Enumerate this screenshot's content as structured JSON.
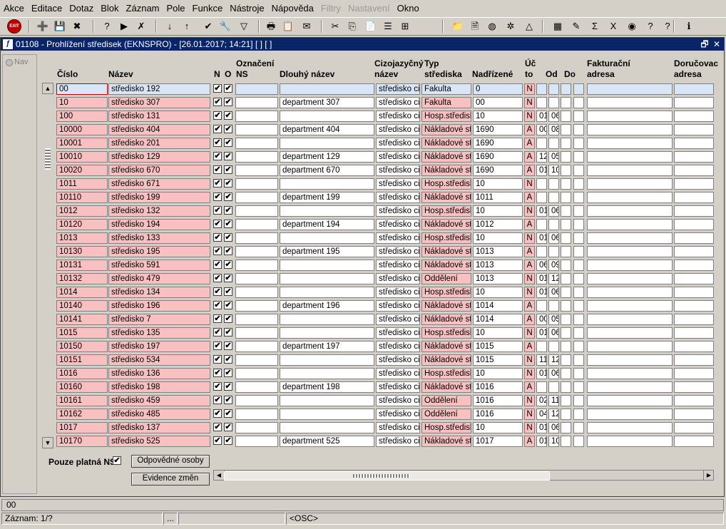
{
  "menu": [
    "Akce",
    "Editace",
    "Dotaz",
    "Blok",
    "Záznam",
    "Pole",
    "Funkce",
    "Nástroje",
    "Nápověda",
    "Filtry",
    "Nastavení",
    "Okno"
  ],
  "menu_disabled": [
    "Filtry",
    "Nastavení"
  ],
  "toolbar": {
    "exit_label": "EXIT",
    "icons": [
      "exit-icon",
      "insert-record-icon",
      "save-icon",
      "delete-record-icon",
      "enter-query-icon",
      "execute-query-icon",
      "cancel-query-icon",
      "sort-ascending-icon",
      "sort-descending-icon",
      "confirm-icon",
      "wrench-icon",
      "filter-icon",
      "print-icon",
      "export-icon",
      "email-icon",
      "cut-icon",
      "copy-icon",
      "paste-icon",
      "list-icon",
      "tree-icon",
      "folder-icon",
      "document-icon",
      "globe-icon",
      "settings-icon",
      "chart-icon",
      "calculator-icon",
      "edit-icon",
      "sum-icon",
      "excel-icon",
      "world-icon",
      "help-icon",
      "question-icon",
      "info-icon"
    ]
  },
  "window": {
    "title": "01108 - Prohlížení středisek (EKNSPRO) - [26.01.2017; 14:21] [ ] [ ]",
    "restore_glyph": "🗗",
    "close_glyph": "✕"
  },
  "nav": {
    "label": "Nav"
  },
  "columns": [
    {
      "key": "cislo",
      "label": "Číslo"
    },
    {
      "key": "nazev",
      "label": "Název"
    },
    {
      "key": "n",
      "label": "N"
    },
    {
      "key": "o",
      "label": "O"
    },
    {
      "key": "oznaceni",
      "label": "Označení\nNS"
    },
    {
      "key": "dlouhy",
      "label": "Dlouhý název"
    },
    {
      "key": "cizojazycny",
      "label": "Cizojazyčný\nnázev"
    },
    {
      "key": "typ",
      "label": "Typ\nstřediska"
    },
    {
      "key": "nadrizene",
      "label": "Nadřízené"
    },
    {
      "key": "uc",
      "label": "Úč\nto"
    },
    {
      "key": "od",
      "label": "Od"
    },
    {
      "key": "do",
      "label": "Do"
    },
    {
      "key": "fakturacni",
      "label": "Fakturační\nadresa"
    },
    {
      "key": "dorucovaci",
      "label": "Doručovac\nadresa"
    }
  ],
  "rows": [
    {
      "cislo": "00",
      "nazev": "středisko 192",
      "dlouhy": "",
      "ciz": "středisko ciz",
      "typ": "Fakulta",
      "nad": "0",
      "uc": "N",
      "od": "",
      "do": ""
    },
    {
      "cislo": "10",
      "nazev": "středisko 307",
      "dlouhy": "department 307",
      "ciz": "středisko ciz",
      "typ": "Fakulta",
      "nad": "00",
      "uc": "N",
      "od": "",
      "do": ""
    },
    {
      "cislo": "100",
      "nazev": "středisko 131",
      "dlouhy": "",
      "ciz": "středisko ciz",
      "typ": "Hosp.středisk",
      "nad": "10",
      "uc": "N",
      "od": "01",
      "do": "06"
    },
    {
      "cislo": "10000",
      "nazev": "středisko 404",
      "dlouhy": "department 404",
      "ciz": "středisko ciz",
      "typ": "Nákladové stř",
      "nad": "1690",
      "uc": "A",
      "od": "00",
      "do": "08"
    },
    {
      "cislo": "10001",
      "nazev": "středisko 201",
      "dlouhy": "",
      "ciz": "středisko ciz",
      "typ": "Nákladové stř",
      "nad": "1690",
      "uc": "A",
      "od": "",
      "do": ""
    },
    {
      "cislo": "10010",
      "nazev": "středisko 129",
      "dlouhy": "department 129",
      "ciz": "středisko ciz",
      "typ": "Nákladové stř",
      "nad": "1690",
      "uc": "A",
      "od": "12",
      "do": "05"
    },
    {
      "cislo": "10020",
      "nazev": "středisko 670",
      "dlouhy": "department 670",
      "ciz": "středisko ciz",
      "typ": "Nákladové stř",
      "nad": "1690",
      "uc": "A",
      "od": "01",
      "do": "10"
    },
    {
      "cislo": "1011",
      "nazev": "středisko 671",
      "dlouhy": "",
      "ciz": "středisko ciz",
      "typ": "Hosp.středisk",
      "nad": "10",
      "uc": "N",
      "od": "",
      "do": ""
    },
    {
      "cislo": "10110",
      "nazev": "středisko 199",
      "dlouhy": "department 199",
      "ciz": "středisko ciz",
      "typ": "Nákladové stř",
      "nad": "1011",
      "uc": "A",
      "od": "",
      "do": ""
    },
    {
      "cislo": "1012",
      "nazev": "středisko 132",
      "dlouhy": "",
      "ciz": "středisko ciz",
      "typ": "Hosp.středisk",
      "nad": "10",
      "uc": "N",
      "od": "01",
      "do": "06"
    },
    {
      "cislo": "10120",
      "nazev": "středisko 194",
      "dlouhy": "department 194",
      "ciz": "středisko ciz",
      "typ": "Nákladové stř",
      "nad": "1012",
      "uc": "A",
      "od": "",
      "do": ""
    },
    {
      "cislo": "1013",
      "nazev": "středisko 133",
      "dlouhy": "",
      "ciz": "středisko ciz",
      "typ": "Hosp.středisk",
      "nad": "10",
      "uc": "N",
      "od": "01",
      "do": "06"
    },
    {
      "cislo": "10130",
      "nazev": "středisko 195",
      "dlouhy": "department 195",
      "ciz": "středisko ciz",
      "typ": "Nákladové stř",
      "nad": "1013",
      "uc": "A",
      "od": "",
      "do": ""
    },
    {
      "cislo": "10131",
      "nazev": "středisko 591",
      "dlouhy": "",
      "ciz": "středisko ciz",
      "typ": "Nákladové stř",
      "nad": "1013",
      "uc": "A",
      "od": "06",
      "do": "09"
    },
    {
      "cislo": "10132",
      "nazev": "středisko 479",
      "dlouhy": "",
      "ciz": "středisko ciz",
      "typ": "Oddělení",
      "nad": "1013",
      "uc": "N",
      "od": "01",
      "do": "12"
    },
    {
      "cislo": "1014",
      "nazev": "středisko 134",
      "dlouhy": "",
      "ciz": "středisko ciz",
      "typ": "Hosp.středisk",
      "nad": "10",
      "uc": "N",
      "od": "01",
      "do": "06"
    },
    {
      "cislo": "10140",
      "nazev": "středisko 196",
      "dlouhy": "department 196",
      "ciz": "středisko ciz",
      "typ": "Nákladové stř",
      "nad": "1014",
      "uc": "A",
      "od": "",
      "do": ""
    },
    {
      "cislo": "10141",
      "nazev": "středisko 7",
      "dlouhy": "",
      "ciz": "středisko ciz",
      "typ": "Nákladové stř",
      "nad": "1014",
      "uc": "A",
      "od": "00",
      "do": "05"
    },
    {
      "cislo": "1015",
      "nazev": "středisko 135",
      "dlouhy": "",
      "ciz": "středisko ciz",
      "typ": "Hosp.středisk",
      "nad": "10",
      "uc": "N",
      "od": "01",
      "do": "06"
    },
    {
      "cislo": "10150",
      "nazev": "středisko 197",
      "dlouhy": "department 197",
      "ciz": "středisko ciz",
      "typ": "Nákladové stř",
      "nad": "1015",
      "uc": "A",
      "od": "",
      "do": ""
    },
    {
      "cislo": "10151",
      "nazev": "středisko 534",
      "dlouhy": "",
      "ciz": "středisko ciz",
      "typ": "Nákladové stř",
      "nad": "1015",
      "uc": "N",
      "od": "11",
      "do": "12"
    },
    {
      "cislo": "1016",
      "nazev": "středisko 136",
      "dlouhy": "",
      "ciz": "středisko ciz",
      "typ": "Hosp.středisk",
      "nad": "10",
      "uc": "N",
      "od": "01",
      "do": "06"
    },
    {
      "cislo": "10160",
      "nazev": "středisko 198",
      "dlouhy": "department 198",
      "ciz": "středisko ciz",
      "typ": "Nákladové stř",
      "nad": "1016",
      "uc": "A",
      "od": "",
      "do": ""
    },
    {
      "cislo": "10161",
      "nazev": "středisko 459",
      "dlouhy": "",
      "ciz": "středisko ciz",
      "typ": "Oddělení",
      "nad": "1016",
      "uc": "N",
      "od": "02",
      "do": "11"
    },
    {
      "cislo": "10162",
      "nazev": "středisko 485",
      "dlouhy": "",
      "ciz": "středisko ciz",
      "typ": "Oddělení",
      "nad": "1016",
      "uc": "N",
      "od": "04",
      "do": "12"
    },
    {
      "cislo": "1017",
      "nazev": "středisko 137",
      "dlouhy": "",
      "ciz": "středisko ciz",
      "typ": "Hosp.středisk",
      "nad": "10",
      "uc": "N",
      "od": "01",
      "do": "06"
    },
    {
      "cislo": "10170",
      "nazev": "středisko 525",
      "dlouhy": "department 525",
      "ciz": "středisko ciz",
      "typ": "Nákladové stř",
      "nad": "1017",
      "uc": "A",
      "od": "01",
      "do": "10"
    }
  ],
  "footer": {
    "pouze_label": "Pouze platná NS",
    "pouze_checked": true,
    "odpovedne_label": "Odpovědné osoby",
    "evidence_label": "Evidence změn"
  },
  "status": {
    "current_value": "00",
    "zaznam": "Záznam: 1/?",
    "dots": "...",
    "osc": "<OSC>"
  },
  "colors": {
    "title_bg": "#0a246a",
    "pink_cell": "#f8c0c0",
    "selected_cell": "#d8e6f8"
  }
}
